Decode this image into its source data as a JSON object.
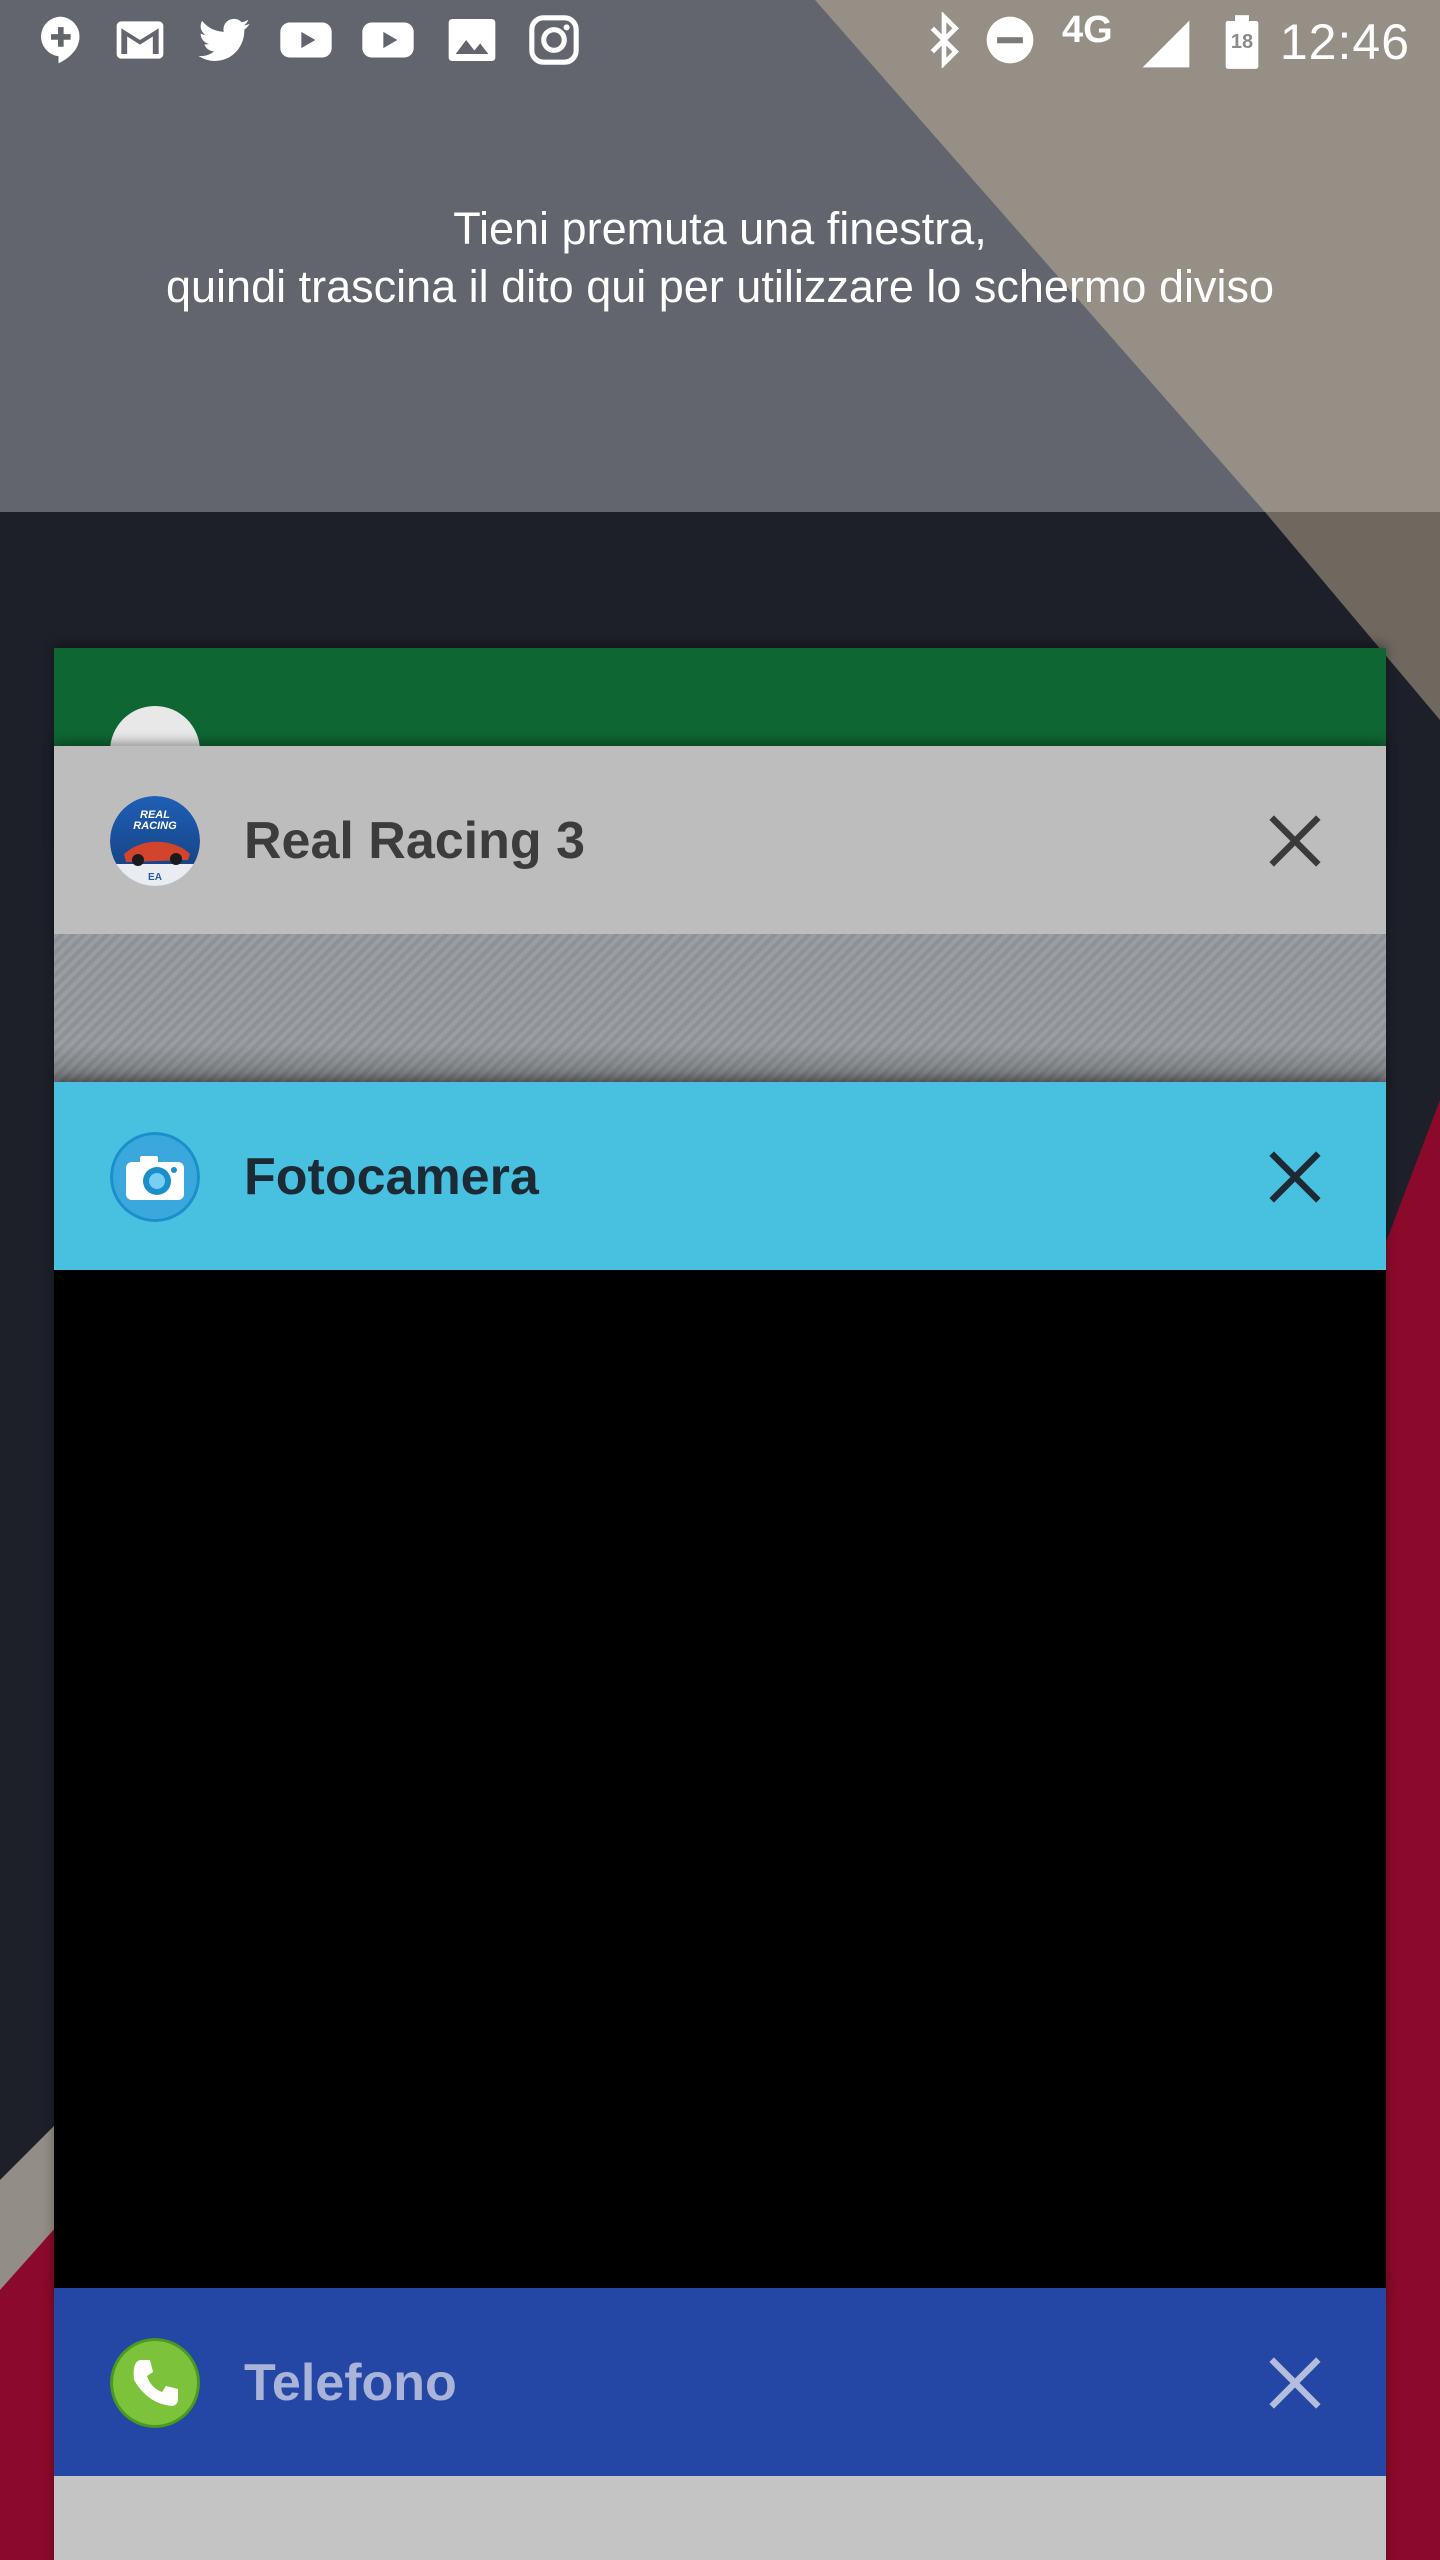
{
  "status_bar": {
    "time": "12:46",
    "network": "4G",
    "battery_level": "18",
    "notification_icons": [
      "hangouts-icon",
      "gmail-icon",
      "twitter-icon",
      "youtube-icon",
      "youtube-icon",
      "gallery-icon",
      "instagram-icon"
    ],
    "system_icons": [
      "bluetooth-icon",
      "do-not-disturb-icon",
      "cell-signal-icon",
      "battery-icon"
    ]
  },
  "split_hint": {
    "line1": "Tieni premuta una finestra,",
    "line2": "quindi trascina il dito qui per utilizzare lo schermo diviso"
  },
  "recents": {
    "cards": [
      {
        "title": "",
        "app": "play-store",
        "header_color": "#0e6633"
      },
      {
        "title": "Real Racing 3",
        "app": "real-racing",
        "header_color": "#bdbdbd"
      },
      {
        "title": "Fotocamera",
        "app": "camera",
        "header_color": "#48c1e0"
      },
      {
        "title": "Telefono",
        "app": "phone",
        "header_color": "#2447a6"
      }
    ]
  },
  "colors": {
    "wallpaper_top": "#62656e",
    "wallpaper_bottom": "#1d2029",
    "wallpaper_beige": "#938e85",
    "wallpaper_red": "#8b0a2b"
  }
}
